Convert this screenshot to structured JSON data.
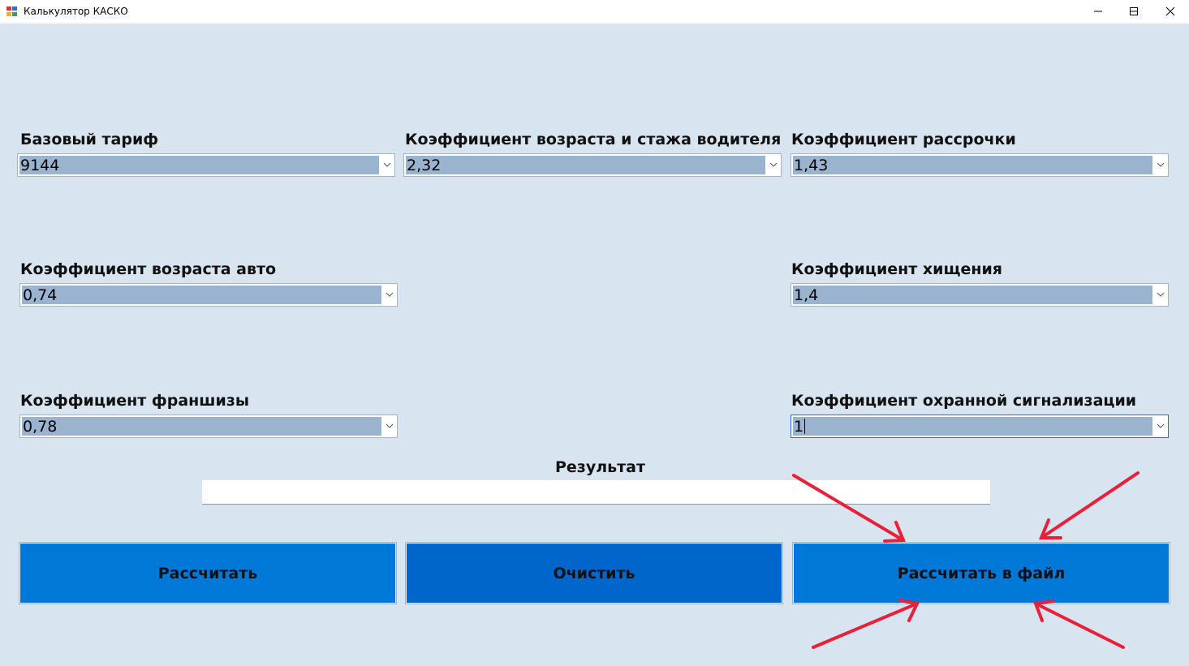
{
  "window": {
    "title": "Калькулятор КАСКО",
    "controls": {
      "minimize": "minimize-icon",
      "maximize": "maximize-icon",
      "close": "close-icon"
    }
  },
  "fields": {
    "base_tariff": {
      "label": "Базовый тариф",
      "value": "9144"
    },
    "driver_age_experience": {
      "label": "Коэффициент возраста и стажа водителя",
      "value": "2,32"
    },
    "installment": {
      "label": "Коэффициент рассрочки",
      "value": "1,43"
    },
    "car_age": {
      "label": "Коэффициент возраста авто",
      "value": "0,74"
    },
    "theft": {
      "label": "Коэффициент хищения",
      "value": "1,4"
    },
    "franchise": {
      "label": "Коэффициент франшизы",
      "value": "0,78"
    },
    "alarm": {
      "label": "Коэффициент охранной сигнализации",
      "value": "1"
    }
  },
  "result": {
    "label": "Результат",
    "value": ""
  },
  "buttons": {
    "calculate": "Рассчитать",
    "clear": "Очистить",
    "calculate_to_file": "Рассчитать в файл"
  },
  "colors": {
    "background": "#d8e4f0",
    "button_blue": "#0078d7",
    "button_blue_dark": "#0066cc",
    "selection": "#9ab3cf",
    "annotation_arrow": "#e8203a"
  }
}
